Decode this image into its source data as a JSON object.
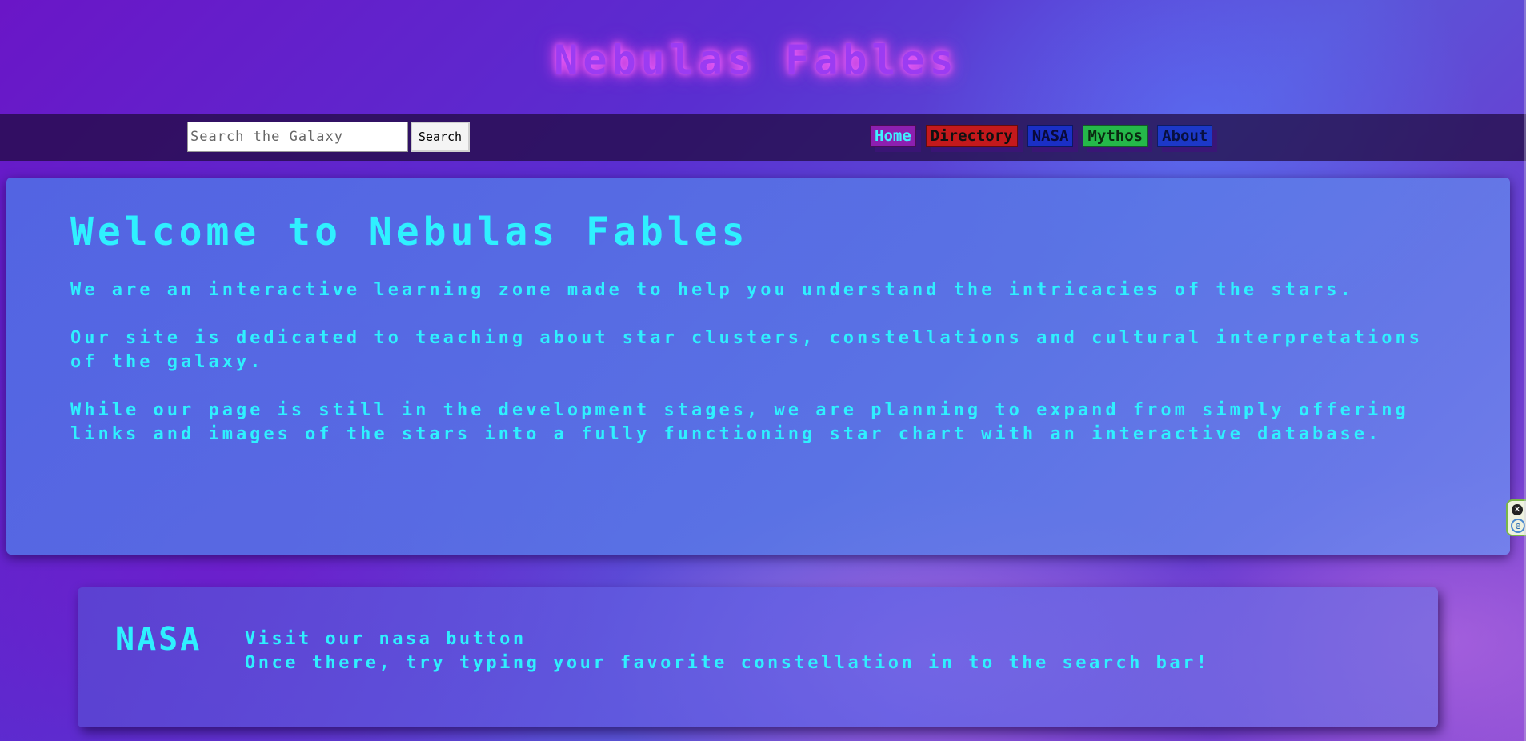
{
  "site": {
    "title": "Nebulas Fables"
  },
  "navbar": {
    "search": {
      "placeholder": "Search the Galaxy",
      "button_label": "Search"
    },
    "links": [
      {
        "label": "Home",
        "color": "#8d1fb0"
      },
      {
        "label": "Directory",
        "color": "#c4191c"
      },
      {
        "label": "NASA",
        "color": "#1a2fc6"
      },
      {
        "label": "Mythos",
        "color": "#25b84a"
      },
      {
        "label": "About",
        "color": "#1c38c8"
      }
    ]
  },
  "welcome": {
    "heading": "Welcome to Nebulas Fables",
    "paragraphs": [
      "We are an interactive learning zone made to help you understand the intricacies of the stars.",
      "Our site is dedicated to teaching about star clusters, constellations and cultural interpretations of the galaxy.",
      "While our page is still in the development stages, we are planning to expand from simply offering links and images of the stars into a fully functioning star chart with an interactive database."
    ]
  },
  "nasa_section": {
    "label": "NASA",
    "line1": "Visit our nasa button",
    "line2": "Once there, try typing your favorite constellation in to the search bar!"
  },
  "extension_widget": {
    "close_icon": "close-icon",
    "e_icon": "e-icon"
  },
  "colors": {
    "accent_text": "#2ff0ff",
    "title": "#9b3cf2"
  }
}
